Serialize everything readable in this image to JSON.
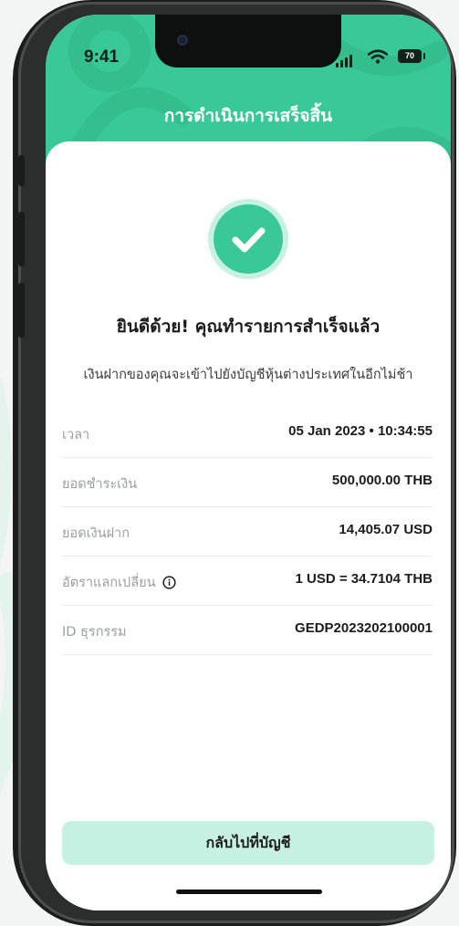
{
  "status_bar": {
    "time": "9:41",
    "battery": "70",
    "icons": [
      "signal-icon",
      "wifi-icon",
      "battery-icon"
    ]
  },
  "header": {
    "title": "การดำเนินการเสร็จสิ้น"
  },
  "success": {
    "icon": "check-circle-icon",
    "title": "ยินดีด้วย! คุณทำรายการสำเร็จแล้ว",
    "subtitle": "เงินฝากของคุณจะเข้าไปยังบัญชีหุ้นต่างประเทศในอีกไม่ช้า"
  },
  "details": [
    {
      "label": "เวลา",
      "value": "05 Jan 2023 • 10:34:55"
    },
    {
      "label": "ยอดชำระเงิน",
      "value": "500,000.00 THB"
    },
    {
      "label": "ยอดเงินฝาก",
      "value": "14,405.07 USD"
    },
    {
      "label": "อัตราแลกเปลี่ยน",
      "value": "1 USD = 34.7104 THB",
      "icon": "info-icon"
    },
    {
      "label": "ID ธุรกรรม",
      "value": "GEDP2023202100001"
    }
  ],
  "actions": {
    "back_label": "กลับไปที่บัญชี"
  },
  "colors": {
    "brand_green": "#39C898",
    "button_bg": "#C6F0E2",
    "page_bg": "#F3F5F4"
  }
}
